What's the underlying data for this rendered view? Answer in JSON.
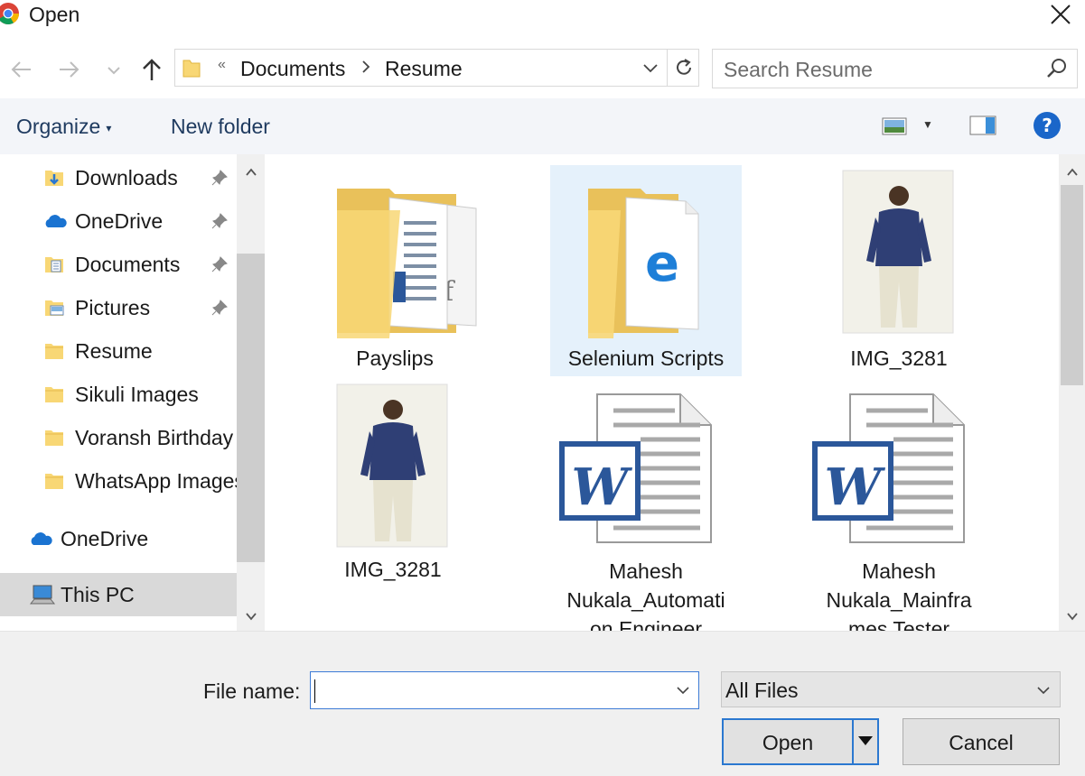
{
  "window": {
    "title": "Open"
  },
  "address": {
    "breadcrumbs": [
      "Documents",
      "Resume"
    ],
    "overflow": "«"
  },
  "search": {
    "placeholder": "Search Resume"
  },
  "toolbar": {
    "organize_label": "Organize",
    "new_folder_label": "New folder"
  },
  "nav": {
    "items": [
      {
        "label": "Downloads",
        "icon": "downloads-folder-icon",
        "pinned": true
      },
      {
        "label": "OneDrive",
        "icon": "onedrive-cloud-icon",
        "pinned": true
      },
      {
        "label": "Documents",
        "icon": "documents-folder-icon",
        "pinned": true
      },
      {
        "label": "Pictures",
        "icon": "pictures-folder-icon",
        "pinned": true
      },
      {
        "label": "Resume",
        "icon": "folder-icon",
        "pinned": false
      },
      {
        "label": "Sikuli Images",
        "icon": "folder-icon",
        "pinned": false
      },
      {
        "label": "Voransh Birthday",
        "icon": "folder-icon",
        "pinned": false
      },
      {
        "label": "WhatsApp Images",
        "icon": "folder-icon",
        "pinned": false
      }
    ],
    "onedrive_label": "OneDrive",
    "thispc_label": "This PC"
  },
  "files": [
    {
      "name": "Payslips",
      "type": "folder-docs"
    },
    {
      "name": "Selenium Scripts",
      "type": "folder-edge",
      "selected": true
    },
    {
      "name": "IMG_3281",
      "type": "photo"
    },
    {
      "name": "IMG_3281",
      "type": "photo"
    },
    {
      "name_lines": [
        "Mahesh",
        "Nukala_Automati",
        "on Engineer"
      ],
      "type": "word"
    },
    {
      "name_lines": [
        "Mahesh",
        "Nukala_Mainfra",
        "mes Tester"
      ],
      "type": "word"
    }
  ],
  "bottom": {
    "file_name_label": "File name:",
    "file_name_value": "",
    "file_type_value": "All Files",
    "open_label": "Open",
    "cancel_label": "Cancel"
  },
  "colors": {
    "accent": "#2b78d0",
    "folder": "#f8d775",
    "word_blue": "#2b579a",
    "selection": "#e5f1fb"
  }
}
